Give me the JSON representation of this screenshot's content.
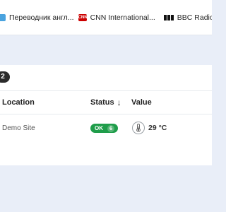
{
  "bookmarks": [
    {
      "icon": "translate-icon",
      "label": "Переводник англ..."
    },
    {
      "icon": "cnn-logo-icon",
      "icon_text": "CNN",
      "label": "CNN International..."
    },
    {
      "icon": "bbc-logo-icon",
      "label": "BBC Radio Scotlan..."
    }
  ],
  "count_badge": "2",
  "table": {
    "headers": {
      "location": "Location",
      "status": "Status",
      "status_sort_icon": "sort-descending-icon",
      "value": "Value"
    },
    "rows": [
      {
        "location": "Demo Site",
        "status": "OK",
        "status_count": "6",
        "status_color": "#1f9d4a",
        "value_icon": "thermometer-icon",
        "value": "29 °C"
      }
    ]
  },
  "colors": {
    "page_bg": "#e9eef8",
    "panel_bg": "#ffffff",
    "ok_green": "#1f9d4a",
    "badge_dark": "#2b2b2b"
  }
}
